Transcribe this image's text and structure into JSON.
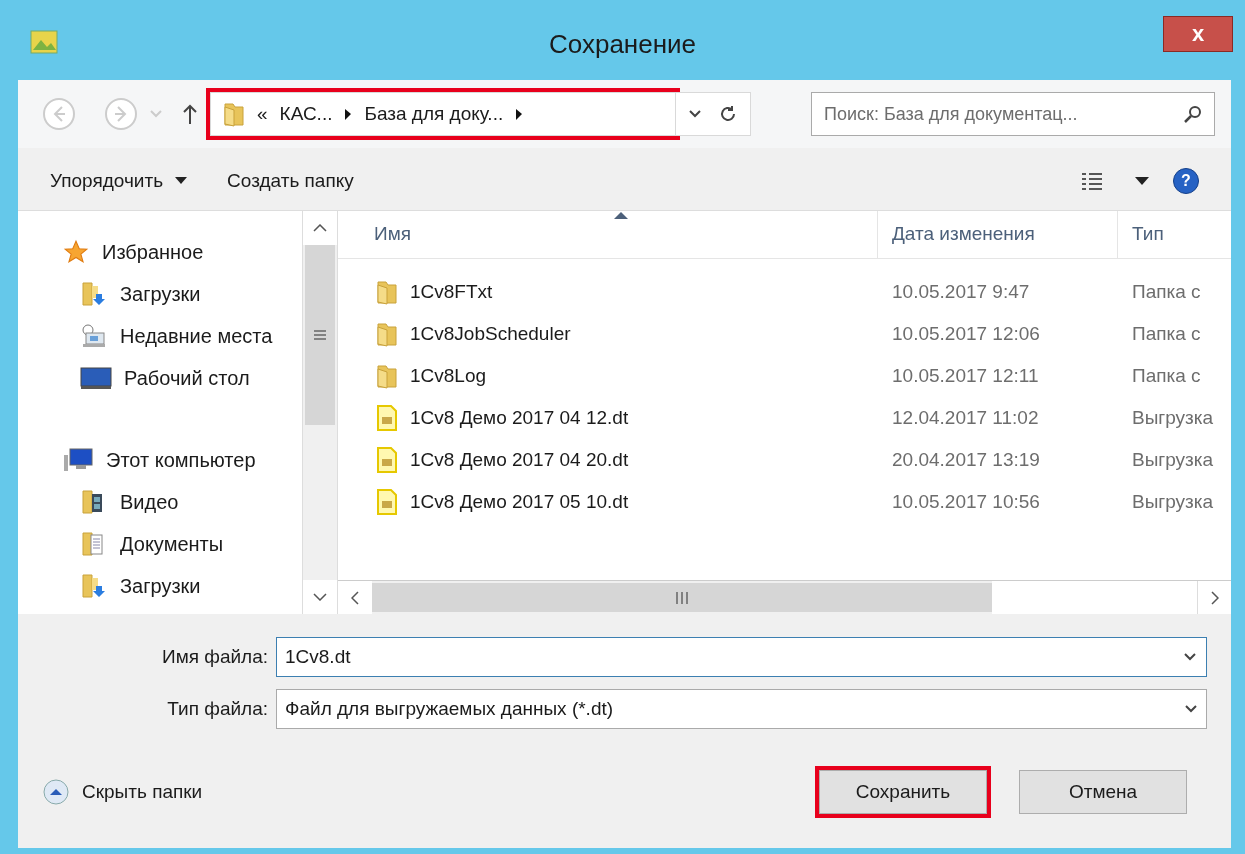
{
  "window": {
    "title": "Сохранение",
    "close_label": "x"
  },
  "address": {
    "parts": [
      "«",
      "КАС...",
      "База для доку..."
    ],
    "highlighted": true
  },
  "search": {
    "placeholder": "Поиск: База для документац..."
  },
  "toolbar": {
    "organize": "Упорядочить",
    "new_folder": "Создать папку",
    "help": "?"
  },
  "sidebar": {
    "groups": [
      {
        "label": "Избранное",
        "kind": "favorites",
        "children": [
          {
            "label": "Загрузки",
            "kind": "downloads"
          },
          {
            "label": "Недавние места",
            "kind": "recent"
          },
          {
            "label": "Рабочий стол",
            "kind": "desktop"
          }
        ]
      },
      {
        "label": "Этот компьютер",
        "kind": "computer",
        "children": [
          {
            "label": "Видео",
            "kind": "video"
          },
          {
            "label": "Документы",
            "kind": "documents"
          },
          {
            "label": "Загрузки",
            "kind": "downloads"
          }
        ]
      }
    ]
  },
  "table": {
    "columns": [
      "Имя",
      "Дата изменения",
      "Тип"
    ],
    "rows": [
      {
        "kind": "folder",
        "name": "1Cv8FTxt",
        "date": "10.05.2017 9:47",
        "type": "Папка с"
      },
      {
        "kind": "folder",
        "name": "1Cv8JobScheduler",
        "date": "10.05.2017 12:06",
        "type": "Папка с"
      },
      {
        "kind": "folder",
        "name": "1Cv8Log",
        "date": "10.05.2017 12:11",
        "type": "Папка с"
      },
      {
        "kind": "file",
        "name": "1Cv8 Демо 2017 04 12.dt",
        "date": "12.04.2017 11:02",
        "type": "Выгрузка"
      },
      {
        "kind": "file",
        "name": "1Cv8 Демо 2017 04 20.dt",
        "date": "20.04.2017 13:19",
        "type": "Выгрузка"
      },
      {
        "kind": "file",
        "name": "1Cv8 Демо 2017 05 10.dt",
        "date": "10.05.2017 10:56",
        "type": "Выгрузка"
      }
    ]
  },
  "form": {
    "filename_label": "Имя файла:",
    "filename_value": "1Cv8.dt",
    "filetype_label": "Тип файла:",
    "filetype_value": "Файл для выгружаемых данных (*.dt)"
  },
  "hide_folders": "Скрыть папки",
  "buttons": [
    {
      "label": "Сохранить",
      "highlighted": true
    },
    {
      "label": "Отмена",
      "highlighted": false
    }
  ]
}
